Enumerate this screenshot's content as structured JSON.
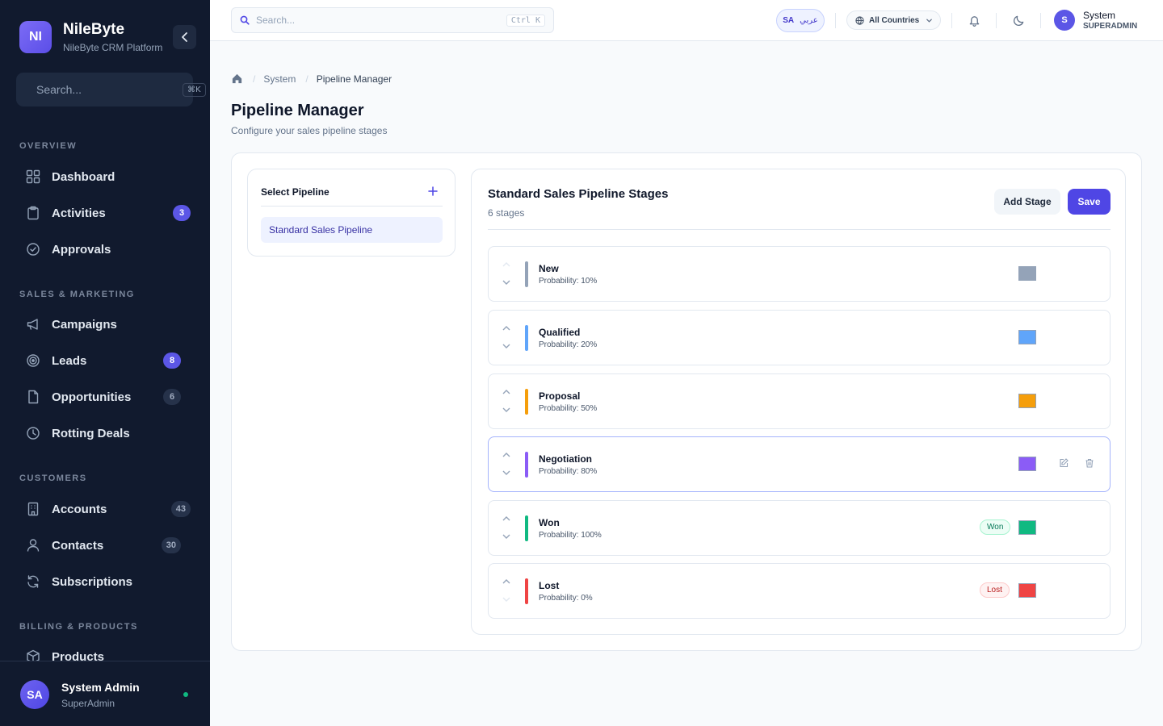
{
  "brand": {
    "initials": "NI",
    "name": "NileByte",
    "subtitle": "NileByte CRM Platform"
  },
  "sidebar": {
    "search_placeholder": "Search...",
    "search_shortcut": "⌘K",
    "sections": {
      "overview": "OVERVIEW",
      "sales": "SALES & MARKETING",
      "customers": "CUSTOMERS",
      "billing": "BILLING & PRODUCTS"
    },
    "items": [
      {
        "label": "Dashboard",
        "icon": "grid-icon"
      },
      {
        "label": "Activities",
        "icon": "clipboard-icon",
        "badge": "3"
      },
      {
        "label": "Approvals",
        "icon": "check-circle-icon"
      },
      {
        "label": "Campaigns",
        "icon": "megaphone-icon"
      },
      {
        "label": "Leads",
        "icon": "target-icon",
        "badge": "8"
      },
      {
        "label": "Opportunities",
        "icon": "file-icon",
        "badge": "6"
      },
      {
        "label": "Rotting Deals",
        "icon": "clock-icon"
      },
      {
        "label": "Accounts",
        "icon": "building-icon",
        "badge": "43"
      },
      {
        "label": "Contacts",
        "icon": "user-icon",
        "badge": "30"
      },
      {
        "label": "Subscriptions",
        "icon": "refresh-icon"
      },
      {
        "label": "Products",
        "icon": "package-icon"
      }
    ],
    "user": {
      "initials": "SA",
      "name": "System Admin",
      "role": "SuperAdmin"
    }
  },
  "topbar": {
    "search_placeholder": "Search...",
    "search_shortcut": "Ctrl K",
    "lang_code": "SA",
    "lang_label": "عربي",
    "country": "All Countries",
    "user": {
      "initials": "S",
      "name": "System",
      "role": "SUPERADMIN"
    }
  },
  "breadcrumb": {
    "section": "System",
    "current": "Pipeline Manager"
  },
  "page": {
    "title": "Pipeline Manager",
    "subtitle": "Configure your sales pipeline stages"
  },
  "pipelines": {
    "title": "Select Pipeline",
    "items": [
      "Standard Sales Pipeline"
    ]
  },
  "stages": {
    "title": "Standard Sales Pipeline Stages",
    "count": "6 stages",
    "add_label": "Add Stage",
    "save_label": "Save",
    "items": [
      {
        "name": "New",
        "probability": "Probability: 10%",
        "color": "#94a3b8",
        "tag": ""
      },
      {
        "name": "Qualified",
        "probability": "Probability: 20%",
        "color": "#60a5fa",
        "tag": ""
      },
      {
        "name": "Proposal",
        "probability": "Probability: 50%",
        "color": "#f59e0b",
        "tag": ""
      },
      {
        "name": "Negotiation",
        "probability": "Probability: 80%",
        "color": "#8b5cf6",
        "tag": ""
      },
      {
        "name": "Won",
        "probability": "Probability: 100%",
        "color": "#10b981",
        "tag": "Won"
      },
      {
        "name": "Lost",
        "probability": "Probability: 0%",
        "color": "#ef4444",
        "tag": "Lost"
      }
    ]
  },
  "colors": {
    "accent": "#4f46e5",
    "sidebar_bg": "#111a2e"
  }
}
